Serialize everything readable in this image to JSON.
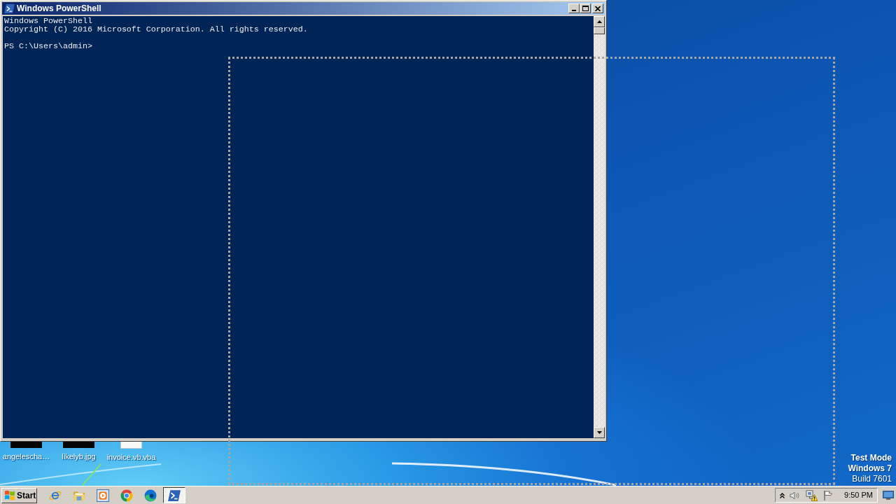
{
  "window": {
    "title": "Windows PowerShell",
    "console": {
      "banner": [
        "Windows PowerShell",
        "Copyright (C) 2016 Microsoft Corporation. All rights reserved."
      ],
      "prompt": "PS C:\\Users\\admin>"
    }
  },
  "desktop_icons": [
    {
      "label": "angelescha…",
      "kind": "dark"
    },
    {
      "label": "likelyb.jpg",
      "kind": "dark"
    },
    {
      "label": "invoice.vb.vba",
      "kind": "light"
    }
  ],
  "desktop_notice": [
    {
      "text": "Test Mode",
      "bold": true
    },
    {
      "text": "Windows 7",
      "bold": true
    },
    {
      "text": "Build 7601",
      "bold": false
    }
  ],
  "taskbar": {
    "start": "Start",
    "apps": [
      {
        "kind": "ie",
        "selected": false
      },
      {
        "kind": "explorer",
        "selected": false
      },
      {
        "kind": "media",
        "selected": false
      },
      {
        "kind": "chrome",
        "selected": false
      },
      {
        "kind": "edge",
        "selected": false
      },
      {
        "kind": "powershell",
        "selected": true
      }
    ],
    "tray": {
      "clock": "9:50 PM"
    }
  }
}
